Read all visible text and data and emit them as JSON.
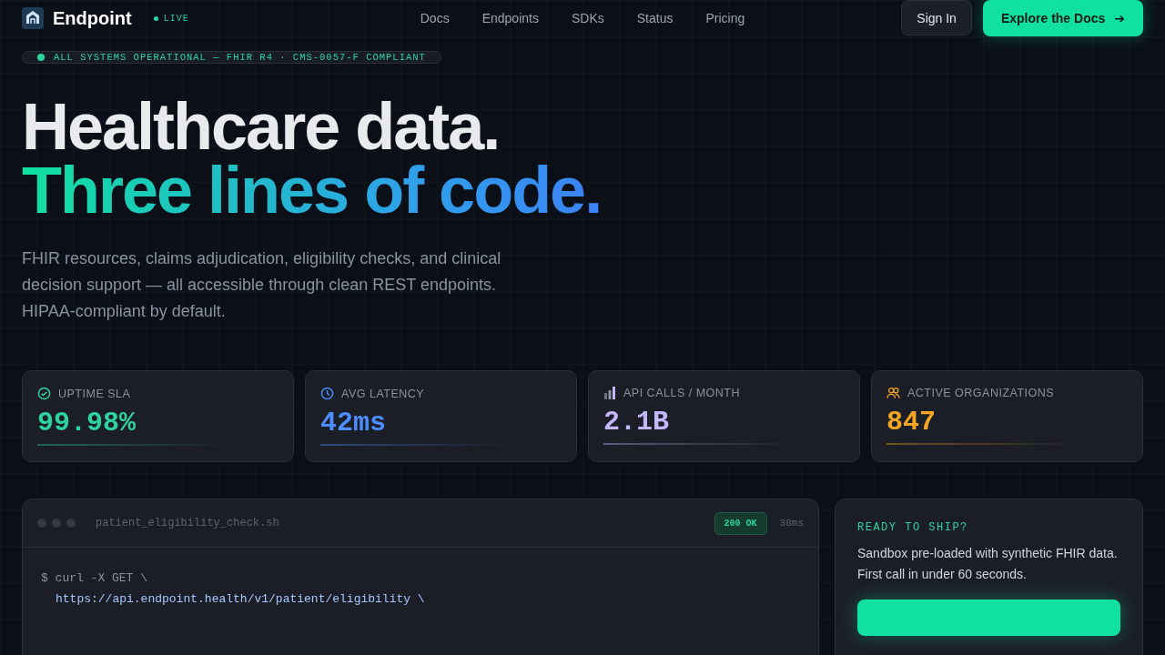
{
  "header": {
    "brand": "Endpoint",
    "live_badge": "LIVE",
    "nav": [
      "Docs",
      "Endpoints",
      "SDKs",
      "Status",
      "Pricing"
    ],
    "sign_in": "Sign In",
    "cta": "Explore the Docs",
    "cta_arrow": "➔"
  },
  "status_pill": "ALL SYSTEMS OPERATIONAL — FHIR R4 · CMS-0057-F COMPLIANT",
  "hero": {
    "title_line_1": "Healthcare data.",
    "title_line_2": "Three lines of code.",
    "description": "FHIR resources, claims adjudication, eligibility checks, and clinical decision support — all accessible through clean REST endpoints. HIPAA-compliant by default."
  },
  "stats": [
    {
      "kind": "uptime",
      "label": "UPTIME SLA",
      "value": "99.98%",
      "color": "#2dd4a0"
    },
    {
      "kind": "latency",
      "label": "AVG LATENCY",
      "value": "42ms",
      "color": "#4c8dff"
    },
    {
      "kind": "calls",
      "label": "API CALLS / MONTH",
      "value": "2.1B",
      "color": "#c4b5fd"
    },
    {
      "kind": "orgs",
      "label": "ACTIVE ORGANIZATIONS",
      "value": "847",
      "color": "#f5a524"
    }
  ],
  "code_panel": {
    "filename": "patient_eligibility_check.sh",
    "status": "200 OK",
    "time": "38ms",
    "lines": [
      {
        "kind": "command",
        "text": "$ curl -X GET \\"
      },
      {
        "kind": "url",
        "text": "https://api.endpoint.health/v1/patient/eligibility \\"
      }
    ]
  },
  "ship_panel": {
    "eyebrow": "READY TO SHIP?",
    "text": "Sandbox pre-loaded with synthetic FHIR data. First call in under 60 seconds."
  }
}
